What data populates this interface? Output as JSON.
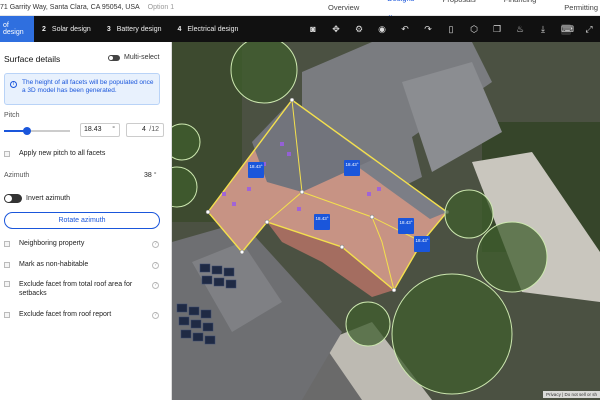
{
  "topbar": {
    "address": "71 Garrity Way, Santa Clara, CA 95054, USA",
    "option": "Option 1",
    "nav": [
      {
        "label": "Overview"
      },
      {
        "label": "Designs ⌄"
      },
      {
        "label": "Proposals ⌄"
      },
      {
        "label": "Financing ⌄"
      },
      {
        "label": "Permitting"
      }
    ]
  },
  "steps": [
    {
      "num": "",
      "label": "of design"
    },
    {
      "num": "2",
      "label": "Solar design"
    },
    {
      "num": "3",
      "label": "Battery design"
    },
    {
      "num": "4",
      "label": "Electrical design"
    }
  ],
  "tools": [
    "camera-icon",
    "move-icon",
    "settings-icon",
    "eye-icon",
    "undo-icon",
    "redo-icon",
    "delete-icon",
    "cube-icon",
    "copy-icon",
    "brush-icon",
    "download-icon",
    "keyboard-icon",
    "expand-icon"
  ],
  "panel": {
    "title": "Surface details",
    "multi_select": "Multi-select",
    "info": "The height of all facets will be populated once a 3D model has been generated.",
    "pitch_label": "Pitch",
    "pitch_value": "18.43",
    "pitch_unit": "°",
    "pitch_ratio": "4",
    "pitch_ratio_unit": "/12",
    "pitch_fraction": 0.35,
    "apply_pitch": "Apply new pitch to all facets",
    "azimuth_label": "Azimuth",
    "azimuth_value": "38",
    "azimuth_unit": "°",
    "invert_azimuth": "Invert azimuth",
    "rotate_azimuth": "Rotate azimuth",
    "options": [
      {
        "label": "Neighboring property"
      },
      {
        "label": "Mark as non-habitable"
      },
      {
        "label": "Exclude facet from total roof area for setbacks"
      },
      {
        "label": "Exclude facet from roof report"
      }
    ]
  },
  "map": {
    "facet_labels": [
      {
        "text": "18.43°"
      },
      {
        "text": "18.43°"
      },
      {
        "text": "18.43°"
      },
      {
        "text": "18.43°"
      },
      {
        "text": "18.43°"
      }
    ],
    "privacy": "Privacy | Do not sell or sh"
  }
}
